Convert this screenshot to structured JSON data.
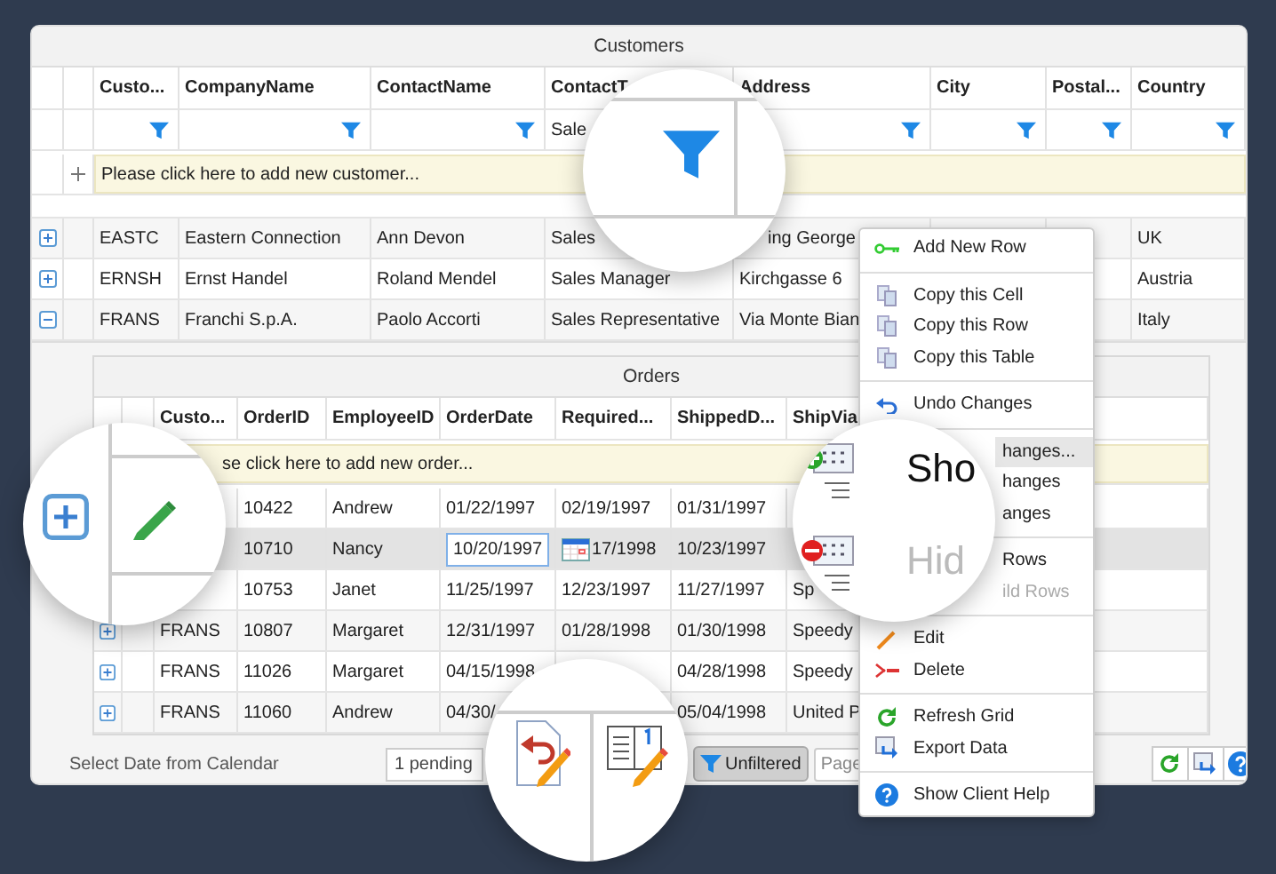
{
  "customers": {
    "title": "Customers",
    "columns": [
      "Custo...",
      "CompanyName",
      "ContactName",
      "ContactT",
      "Address",
      "City",
      "Postal...",
      "Country"
    ],
    "filters": [
      {
        "kind": "icon"
      },
      {
        "kind": "icon"
      },
      {
        "kind": "icon"
      },
      {
        "kind": "text",
        "value": "Sale"
      },
      {
        "kind": "icon"
      },
      {
        "kind": "icon"
      },
      {
        "kind": "icon"
      },
      {
        "kind": "icon"
      }
    ],
    "add_row": "Please click here to add new customer...",
    "rows": [
      {
        "expanded": false,
        "cells": [
          "EASTC",
          "Eastern Connection",
          "Ann Devon",
          "Sales",
          {
            "kind": "covered",
            "value": "ing George"
          },
          null,
          null,
          "UK"
        ]
      },
      {
        "expanded": false,
        "cells": [
          "ERNSH",
          "Ernst Handel",
          "Roland Mendel",
          "Sales Manager",
          "Kirchgasse 6",
          null,
          null,
          "Austria"
        ]
      },
      {
        "expanded": true,
        "cells": [
          "FRANS",
          "Franchi S.p.A.",
          "Paolo Accorti",
          "Sales Representative",
          "Via Monte Bian",
          null,
          null,
          "Italy"
        ]
      }
    ]
  },
  "orders": {
    "title": "Orders",
    "columns": [
      "Custo...",
      "OrderID",
      "EmployeeID",
      "OrderDate",
      "Required...",
      "ShippedD...",
      "ShipVia"
    ],
    "add_row": "se click here to add new order...",
    "rows": [
      {
        "selected": false,
        "cells": [
          null,
          "10422",
          "Andrew",
          "01/22/1997",
          "02/19/1997",
          "01/31/1997",
          null
        ]
      },
      {
        "selected": true,
        "cells": [
          null,
          "10710",
          "Nancy",
          {
            "kind": "input",
            "value": "10/20/1997"
          },
          {
            "kind": "date-picker",
            "value": "17/1998"
          },
          "10/23/1997",
          null
        ]
      },
      {
        "selected": false,
        "cells": [
          null,
          "10753",
          "Janet",
          "11/25/1997",
          "12/23/1997",
          "11/27/1997",
          "Sp"
        ]
      },
      {
        "selected": false,
        "cells": [
          "FRANS",
          "10807",
          "Margaret",
          "12/31/1997",
          "01/28/1998",
          "01/30/1998",
          "Speedy"
        ]
      },
      {
        "selected": false,
        "cells": [
          "FRANS",
          "11026",
          "Margaret",
          "04/15/1998",
          null,
          "04/28/1998",
          "Speedy"
        ]
      },
      {
        "selected": false,
        "cells": [
          "FRANS",
          "11060",
          "Andrew",
          "04/30/",
          null,
          "05/04/1998",
          "United P"
        ]
      }
    ]
  },
  "footer": {
    "status": "Select Date from Calendar",
    "pending": "1 pending",
    "filter_button": "Unfiltered",
    "page_field": {
      "placeholder": "Page"
    }
  },
  "menu": {
    "items": [
      {
        "kind": "add",
        "label": "Add New Row",
        "highlighted": false,
        "disabled": false
      },
      {
        "kind": "separator"
      },
      {
        "kind": "copy",
        "label": "Copy this Cell",
        "highlighted": false,
        "disabled": false
      },
      {
        "kind": "copy",
        "label": "Copy this Row",
        "highlighted": false,
        "disabled": false
      },
      {
        "kind": "copy",
        "label": "Copy this Table",
        "highlighted": false,
        "disabled": false
      },
      {
        "kind": "separator"
      },
      {
        "kind": "undo",
        "label": "Undo Changes",
        "highlighted": false,
        "disabled": false
      },
      {
        "kind": "separator"
      },
      {
        "kind": "covered",
        "label": "hanges...",
        "highlighted": true,
        "disabled": false
      },
      {
        "kind": "covered",
        "label": "hanges",
        "highlighted": false,
        "disabled": false
      },
      {
        "kind": "covered",
        "label": "anges",
        "highlighted": false,
        "disabled": false
      },
      {
        "kind": "separator"
      },
      {
        "kind": "covered",
        "label": "Rows",
        "highlighted": false,
        "disabled": false
      },
      {
        "kind": "covered",
        "label": "ild Rows",
        "highlighted": false,
        "disabled": true
      },
      {
        "kind": "separator"
      },
      {
        "kind": "edit",
        "label": "Edit",
        "highlighted": false,
        "disabled": false
      },
      {
        "kind": "delete",
        "label": "Delete",
        "highlighted": false,
        "disabled": false
      },
      {
        "kind": "separator"
      },
      {
        "kind": "refresh",
        "label": "Refresh Grid",
        "highlighted": false,
        "disabled": false
      },
      {
        "kind": "export",
        "label": "Export Data",
        "highlighted": false,
        "disabled": false
      },
      {
        "kind": "separator"
      },
      {
        "kind": "help",
        "label": "Show Client Help",
        "highlighted": false,
        "disabled": false
      }
    ]
  },
  "magnifiers": [
    {
      "kind": "filter"
    },
    {
      "kind": "edit"
    },
    {
      "kind": "rows",
      "labels": [
        {
          "text": "Sho",
          "disabled": false
        },
        {
          "text": "Hid",
          "disabled": true
        }
      ]
    },
    {
      "kind": "undo"
    }
  ]
}
